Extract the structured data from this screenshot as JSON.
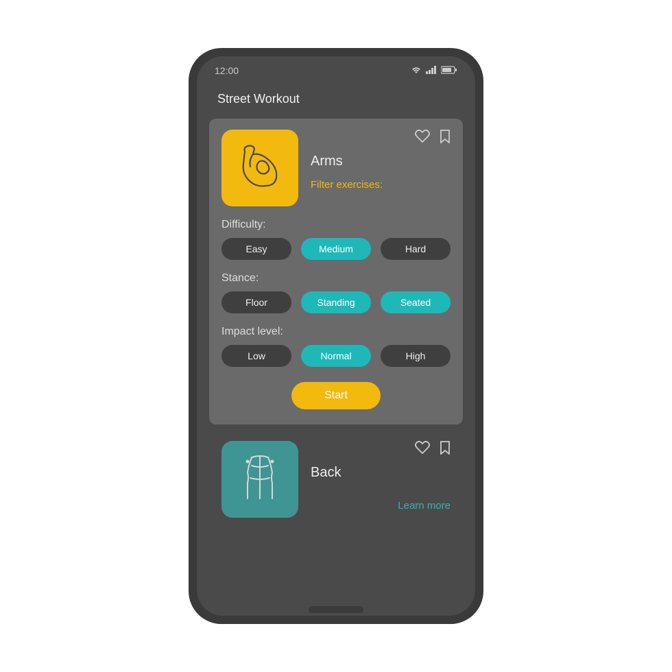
{
  "status": {
    "time": "12:00"
  },
  "app": {
    "title": "Street Workout"
  },
  "cards": {
    "arms": {
      "title": "Arms",
      "filter_label": "Filter exercises:",
      "icon": "bicep-icon",
      "difficulty": {
        "label": "Difficulty:",
        "options": [
          "Easy",
          "Medium",
          "Hard"
        ],
        "selected": [
          "Medium"
        ]
      },
      "stance": {
        "label": "Stance:",
        "options": [
          "Floor",
          "Standing",
          "Seated"
        ],
        "selected": [
          "Standing",
          "Seated"
        ]
      },
      "impact": {
        "label": "Impact level:",
        "options": [
          "Low",
          "Normal",
          "High"
        ],
        "selected": [
          "Normal"
        ]
      },
      "start_label": "Start"
    },
    "back": {
      "title": "Back",
      "icon": "torso-back-icon",
      "learn_more": "Learn more"
    }
  },
  "colors": {
    "accent_yellow": "#f2b90f",
    "accent_teal": "#1fb8b8",
    "bg_dark": "#4a4a4a",
    "card_bg": "#6a6a6a",
    "chip_bg": "#3f3f3f"
  }
}
